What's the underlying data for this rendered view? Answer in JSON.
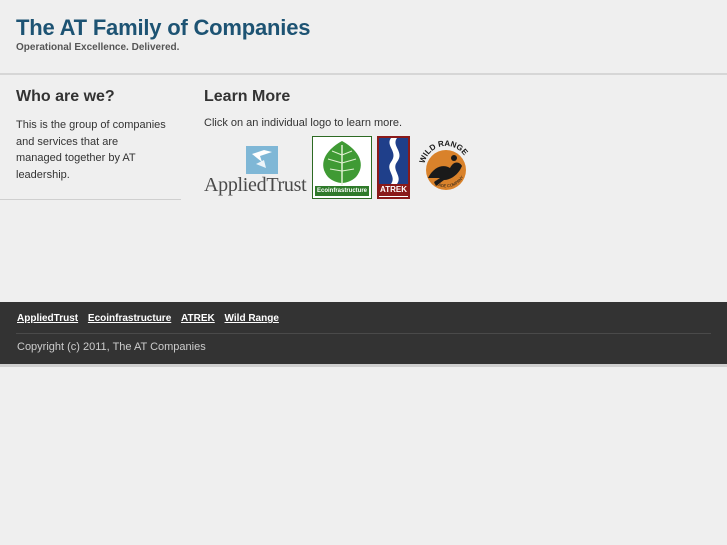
{
  "header": {
    "title": "The AT Family of Companies",
    "tagline": "Operational Excellence. Delivered."
  },
  "about": {
    "heading": "Who are we?",
    "text": "This is the group of companies and services that are managed together by AT leadership."
  },
  "learn": {
    "heading": "Learn More",
    "instruction": "Click on an individual logo to learn more.",
    "logos": {
      "appliedtrust": "AppliedTrust",
      "ecoinfrastructure": "Ecoinfrastructure",
      "atrek": "ATREK",
      "wildrange": "WILD RANGE",
      "wildrange_sub": "TRADE COMPANY"
    }
  },
  "footer": {
    "links": [
      "AppliedTrust",
      "Ecoinfrastructure",
      "ATREK",
      "Wild Range"
    ],
    "copyright": "Copyright (c) 2011, The AT Companies"
  },
  "colors": {
    "title": "#1d5373",
    "footer_bg": "#333333",
    "page_bg": "#efefef",
    "eco_green": "#2f7a2a",
    "atrek_red": "#8a1a1a",
    "applied_blue": "#7fb7d6"
  }
}
